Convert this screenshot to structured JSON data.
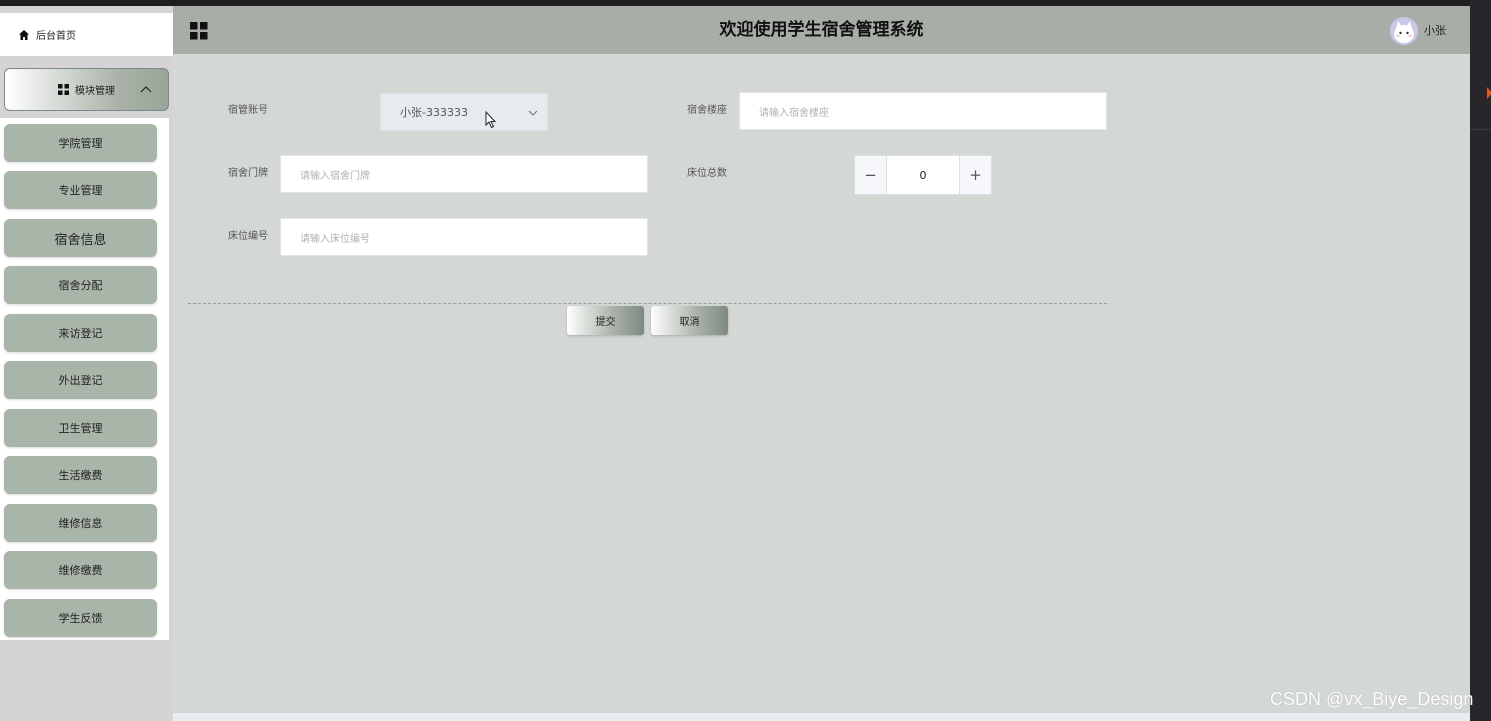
{
  "sidebar": {
    "home_label": "后台首页",
    "module_label": "模块管理",
    "items": [
      {
        "label": "学院管理"
      },
      {
        "label": "专业管理"
      },
      {
        "label": "宿舍信息"
      },
      {
        "label": "宿舍分配"
      },
      {
        "label": "来访登记"
      },
      {
        "label": "外出登记"
      },
      {
        "label": "卫生管理"
      },
      {
        "label": "生活缴费"
      },
      {
        "label": "维修信息"
      },
      {
        "label": "维修缴费"
      },
      {
        "label": "学生反馈"
      }
    ]
  },
  "header": {
    "title": "欢迎使用学生宿舍管理系统",
    "username": "小张"
  },
  "form": {
    "manager_account": {
      "label": "宿管账号",
      "value": "小张-333333"
    },
    "building": {
      "label": "宿舍楼座",
      "placeholder": "请输入宿舍楼座"
    },
    "door": {
      "label": "宿舍门牌",
      "placeholder": "请输入宿舍门牌"
    },
    "bed_total": {
      "label": "床位总数",
      "value": "0",
      "minus": "−",
      "plus": "+"
    },
    "bed_no": {
      "label": "床位编号",
      "placeholder": "请输入床位编号"
    }
  },
  "actions": {
    "submit": "提交",
    "cancel": "取消"
  },
  "watermark": "CSDN @vx_Biye_Design",
  "colors": {
    "header_bg": "#a8aea7",
    "main_bg": "#d4d8d4",
    "menu_item_bg": "#a9b5a8"
  }
}
